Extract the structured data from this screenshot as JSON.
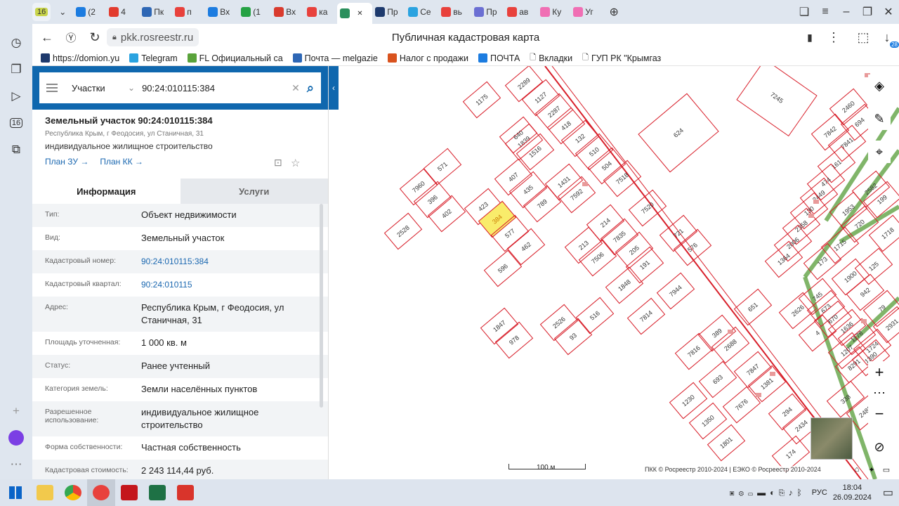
{
  "browser": {
    "tab_counter": "16",
    "tabs": [
      {
        "label": "(2",
        "color": "#1c7ce0"
      },
      {
        "label": "4",
        "color": "#e23b2e"
      },
      {
        "label": "Пк",
        "color": "#2e67b5"
      },
      {
        "label": "п",
        "color": "#e8413c"
      },
      {
        "label": "Вх",
        "color": "#1c7ce0"
      },
      {
        "label": "(1",
        "color": "#25a244"
      },
      {
        "label": "Вх",
        "color": "#d93b2e"
      },
      {
        "label": "ка",
        "color": "#e8413c"
      },
      {
        "label": "",
        "color": "#2a8f5c",
        "active": true
      },
      {
        "label": "Пр",
        "color": "#1e3a6d"
      },
      {
        "label": "Се",
        "color": "#2aa3e0"
      },
      {
        "label": "вь",
        "color": "#e8413c"
      },
      {
        "label": "Пр",
        "color": "#6b6fd3"
      },
      {
        "label": "ав",
        "color": "#e8413c"
      },
      {
        "label": "Ку",
        "color": "#f06fb4"
      },
      {
        "label": "Уг",
        "color": "#f06fb4"
      }
    ],
    "url": "pkk.rosreestr.ru",
    "page_title": "Публичная кадастровая карта",
    "download_badge": "28"
  },
  "bookmarks": [
    {
      "label": "https://domion.yu",
      "color": "#1e3a6d"
    },
    {
      "label": "Telegram",
      "color": "#2aa3e0"
    },
    {
      "label": "FL Официальный са",
      "color": "#5aa33b"
    },
    {
      "label": "Почта — melgazie",
      "color": "#2e67b5"
    },
    {
      "label": "Налог с продажи",
      "color": "#d9531e"
    },
    {
      "label": "ПОЧТА",
      "color": "#1c7ce0"
    },
    {
      "label": "Вкладки",
      "color": ""
    },
    {
      "label": "ГУП РК \"Крымгаз",
      "color": ""
    }
  ],
  "sidebar": {
    "app_badge": "16"
  },
  "panel": {
    "search_scope": "Участки",
    "search_value": "90:24:010115:384",
    "title": "Земельный участок 90:24:010115:384",
    "address_short": "Республика Крым, г Феодосия, ул Станичная, 31",
    "use": "индивидуальное жилищное строительство",
    "link_zu": "План ЗУ →",
    "link_kk": "План КК →",
    "tab_info": "Информация",
    "tab_services": "Услуги",
    "rows": [
      {
        "k": "Тип:",
        "v": "Объект недвижимости"
      },
      {
        "k": "Вид:",
        "v": "Земельный участок"
      },
      {
        "k": "Кадастровый номер:",
        "v": "90:24:010115:384",
        "link": true
      },
      {
        "k": "Кадастровый квартал:",
        "v": "90:24:010115",
        "link": true
      },
      {
        "k": "Адрес:",
        "v": "Республика Крым, г Феодосия, ул Станичная, 31"
      },
      {
        "k": "Площадь уточненная:",
        "v": "1 000 кв. м"
      },
      {
        "k": "Статус:",
        "v": "Ранее учтенный"
      },
      {
        "k": "Категория земель:",
        "v": "Земли населённых пунктов"
      },
      {
        "k": "Разрешенное использование:",
        "v": "индивидуальное жилищное строительство"
      },
      {
        "k": "Форма собственности:",
        "v": "Частная собственность"
      },
      {
        "k": "Кадастровая стоимость:",
        "v": "2 243 114,44 руб."
      }
    ]
  },
  "map": {
    "parcels": [
      "1175",
      "2289",
      "1127",
      "2287",
      "418",
      "132",
      "510",
      "504",
      "7518",
      "624",
      "7245",
      "1839",
      "640",
      "1516",
      "407",
      "435",
      "789",
      "1431",
      "7592",
      "7960",
      "571",
      "396",
      "402",
      "423",
      "384",
      "577",
      "462",
      "596",
      "2528",
      "213",
      "214",
      "7835",
      "7506",
      "205",
      "191",
      "1848",
      "7520",
      "721",
      "576",
      "7944",
      "7814",
      "1847",
      "978",
      "2526",
      "93",
      "516",
      "651",
      "389",
      "2688",
      "7816",
      "693",
      "7847",
      "1381",
      "7676",
      "1230",
      "1350",
      "1801",
      "294",
      "2434",
      "174",
      "338",
      "2460",
      "694",
      "7842",
      "7841",
      "161",
      "474",
      "2449",
      "130",
      "2358",
      "2006",
      "1364",
      "1953",
      "720",
      "1718",
      "2582",
      "199",
      "1715",
      "173",
      "1900",
      "125",
      "942",
      "79",
      "745",
      "2626",
      "673",
      "670",
      "4",
      "1636",
      "1178",
      "1207",
      "2931",
      "1724",
      "8291",
      "1390",
      "2483"
    ],
    "selected_parcel": "384",
    "scale_label": "100 м",
    "attribution": "ПКК © Росреестр 2010-2024 | ЕЭКО © Росреестр 2010-2024"
  },
  "taskbar": {
    "lang": "РУС",
    "time": "18:04",
    "date": "26.09.2024"
  }
}
